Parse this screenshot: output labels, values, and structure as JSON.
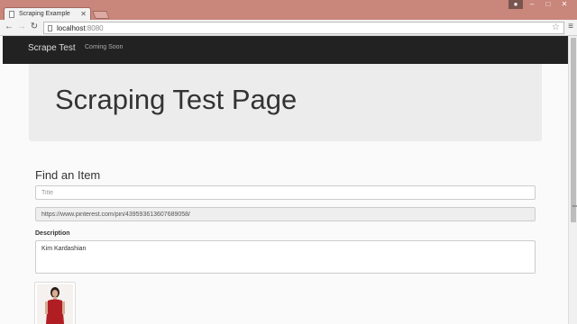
{
  "browser": {
    "tab_title": "Scraping Example",
    "url_host": "localhost",
    "url_port": ":8080"
  },
  "navbar": {
    "brand": "Scrape Test",
    "link": "Coming Soon"
  },
  "jumbotron": {
    "heading": "Scraping Test Page"
  },
  "form": {
    "section_title": "Find an Item",
    "title_placeholder": "Title",
    "url_value": "https://www.pinterest.com/pin/439593613607689058/",
    "description_label": "Description",
    "description_value": "Kim Kardashian"
  },
  "colors": {
    "navbar_bg": "#222222",
    "jumbotron_bg": "#ececec",
    "dress_red": "#b01e24"
  },
  "icons": [
    "back-arrow-icon",
    "forward-arrow-icon",
    "reload-icon",
    "page-icon",
    "star-icon",
    "menu-icon",
    "close-icon"
  ]
}
